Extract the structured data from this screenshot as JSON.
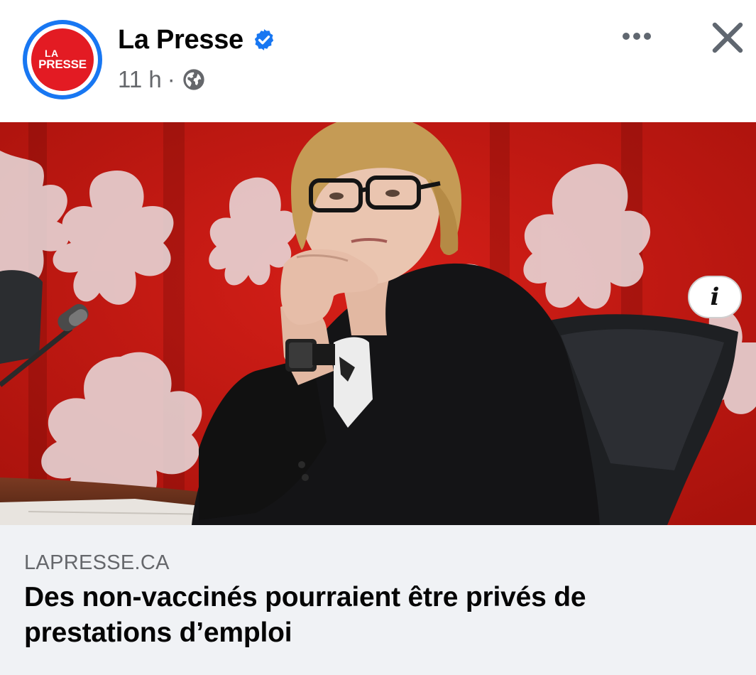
{
  "post": {
    "page_name": "La Presse",
    "avatar_text": {
      "line1": "LA",
      "line2": "PRESSE"
    },
    "timestamp": "11 h",
    "separator": "·",
    "audience_icon": "globe-icon",
    "verified_icon": "verified-badge-icon",
    "more_icon": "more-options-icon",
    "close_icon": "close-icon"
  },
  "link_preview": {
    "domain": "LAPRESSE.CA",
    "headline": "Des non-vaccinés pourraient être privés de prestations d’emploi",
    "info_button_label": "i"
  },
  "colors": {
    "brand_blue": "#1877f2",
    "brand_red": "#e31b23",
    "caption_bg": "#f0f2f5",
    "meta_gray": "#65676b"
  }
}
